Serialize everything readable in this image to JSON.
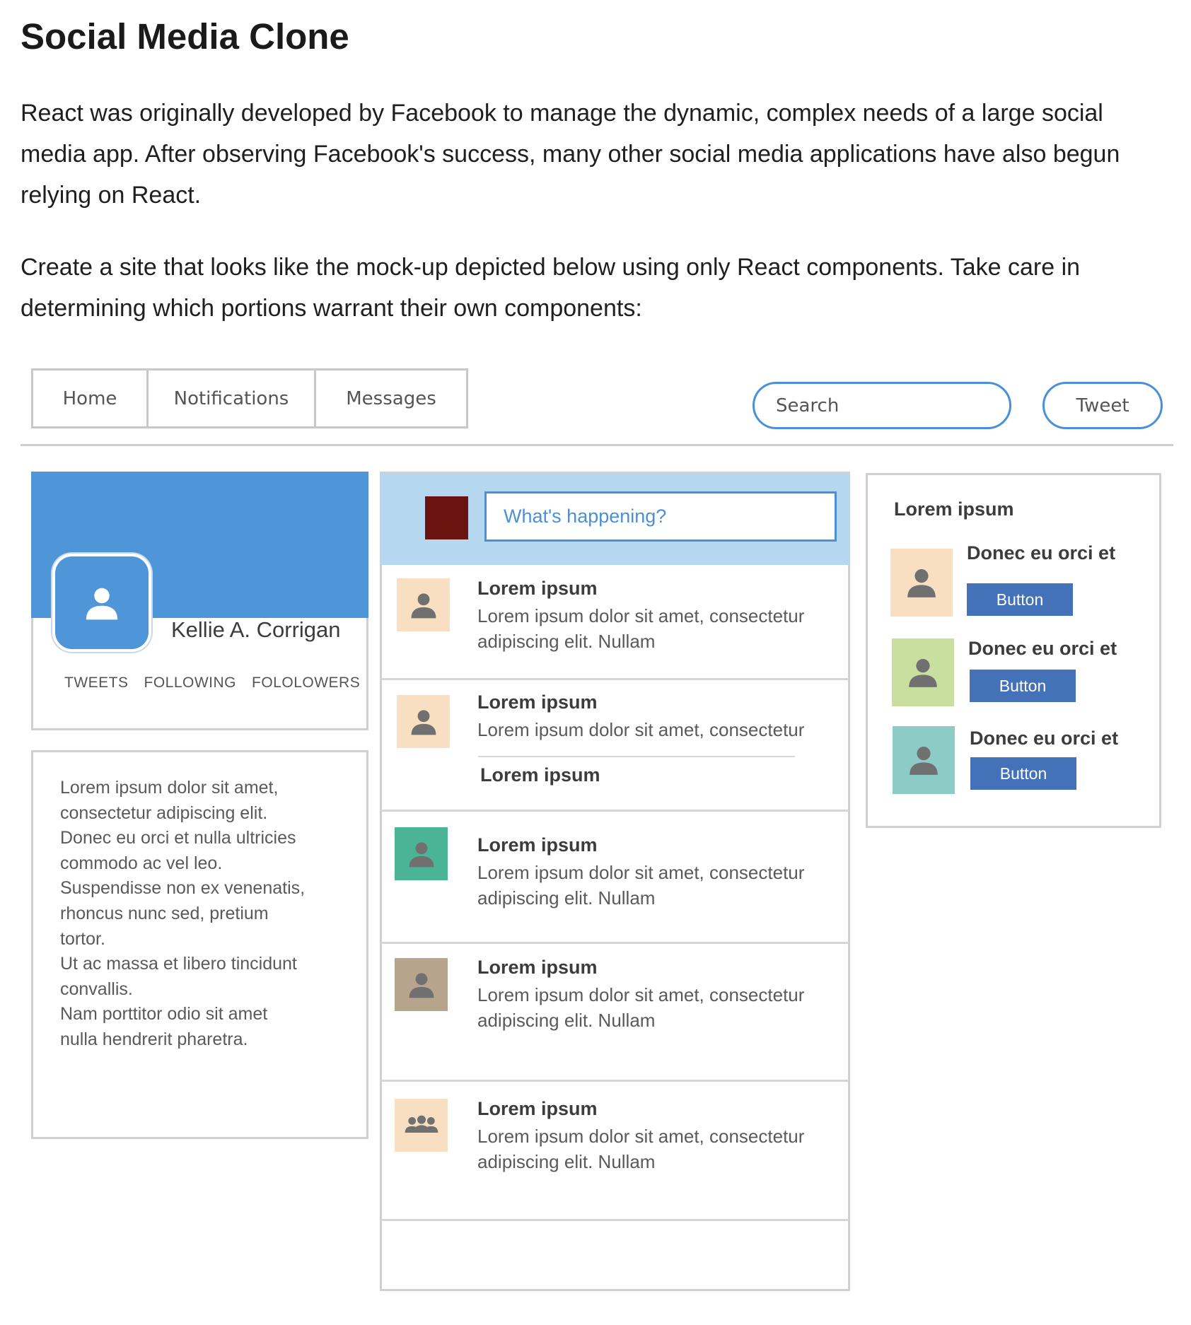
{
  "document": {
    "title": "Social Media Clone",
    "paragraph1_lines": [
      "React was originally developed by Facebook to manage the dynamic, complex needs of a large social",
      "media app. After observing Facebook's success, many other social media applications have also begun",
      "relying on React."
    ],
    "paragraph2_lines": [
      "Create a site that looks like the mock-up depicted below using only React components. Take care in",
      "determining which portions warrant their own components:"
    ]
  },
  "mockup": {
    "nav": {
      "home": "Home",
      "notifications": "Notifications",
      "messages": "Messages"
    },
    "search_placeholder": "Search",
    "tweet_button": "Tweet",
    "profile": {
      "name": "Kellie A. Corrigan",
      "stats": [
        "TWEETS",
        "FOLLOWING",
        "FOLOLOWERS"
      ],
      "banner_color": "#4f96d8"
    },
    "about_lines": [
      "Lorem ipsum dolor sit amet,",
      "consectetur adipiscing elit.",
      "Donec eu orci et nulla ultricies",
      "commodo ac vel leo.",
      "Suspendisse non ex venenatis,",
      "rhoncus nunc sed, pretium",
      "tortor.",
      "Ut ac massa et libero tincidunt",
      "convallis.",
      "Nam porttitor odio sit amet",
      "nulla hendrerit pharetra."
    ],
    "compose_placeholder": "What's happening?",
    "feed": [
      {
        "title": "Lorem ipsum",
        "line1": "Lorem ipsum dolor sit amet, consectetur",
        "line2": "adipiscing elit. Nullam",
        "avatar_color": "#f9dfc2",
        "icon": "person-icon"
      },
      {
        "title": "Lorem ipsum",
        "line1": "Lorem ipsum dolor sit amet, consectetur",
        "reply_title": "Lorem ipsum",
        "avatar_color": "#f9dfc2",
        "icon": "person-icon"
      },
      {
        "title": "Lorem ipsum",
        "line1": "Lorem ipsum dolor sit amet, consectetur",
        "line2": "adipiscing elit. Nullam",
        "avatar_color": "#4bb497",
        "icon": "person-icon"
      },
      {
        "title": "Lorem ipsum",
        "line1": "Lorem ipsum dolor sit amet, consectetur",
        "line2": "adipiscing elit. Nullam",
        "avatar_color": "#b6a48c",
        "icon": "person-icon"
      },
      {
        "title": "Lorem ipsum",
        "line1": "Lorem ipsum dolor sit amet, consectetur",
        "line2": "adipiscing elit. Nullam",
        "avatar_color": "#f9dfc2",
        "icon": "group-icon"
      }
    ],
    "sidebar": {
      "heading": "Lorem ipsum",
      "suggestions": [
        {
          "name": "Donec eu orci et",
          "button": "Button",
          "avatar_color": "#f9dfc2"
        },
        {
          "name": "Donec eu orci et",
          "button": "Button",
          "avatar_color": "#c9df9f"
        },
        {
          "name": "Donec eu orci et",
          "button": "Button",
          "avatar_color": "#8dcbc7"
        }
      ]
    },
    "colors": {
      "accent_blue": "#4a90d9",
      "compose_bg": "#b5d7f0",
      "compose_avatar": "#6b130e",
      "button_blue": "#4472b8"
    }
  }
}
